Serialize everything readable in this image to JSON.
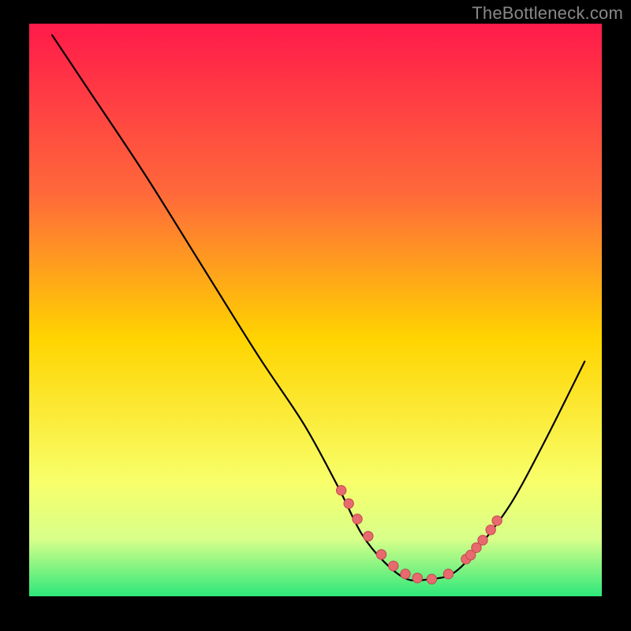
{
  "watermark": "TheBottleneck.com",
  "colors": {
    "background": "#000000",
    "gradient_top": "#ff1a4a",
    "gradient_mid": "#ffd400",
    "gradient_low": "#f8ff6a",
    "gradient_bottom": "#2de87a",
    "curve": "#000000",
    "marker_fill": "#e76a6f",
    "marker_stroke": "#c4494e"
  },
  "chart_data": {
    "type": "line",
    "title": "",
    "xlabel": "",
    "ylabel": "",
    "xlim": [
      0,
      100
    ],
    "ylim": [
      0,
      100
    ],
    "series": [
      {
        "name": "bottleneck-curve",
        "x": [
          4,
          10,
          20,
          30,
          40,
          48,
          54,
          58,
          62,
          66,
          70,
          74,
          78,
          84,
          90,
          97
        ],
        "y": [
          98,
          89,
          74,
          58,
          42,
          30,
          19,
          11,
          6,
          3,
          3,
          4,
          8,
          16,
          27,
          41
        ]
      }
    ],
    "markers": {
      "name": "highlighted-points",
      "x": [
        54.5,
        55.8,
        57.3,
        59.2,
        61.5,
        63.6,
        65.7,
        67.8,
        70.3,
        73.2,
        76.3,
        77.1,
        78.1,
        79.2,
        80.6,
        81.7
      ],
      "y": [
        18.5,
        16.2,
        13.5,
        10.5,
        7.3,
        5.3,
        3.9,
        3.2,
        3.0,
        3.9,
        6.5,
        7.2,
        8.5,
        9.8,
        11.6,
        13.2
      ]
    }
  }
}
